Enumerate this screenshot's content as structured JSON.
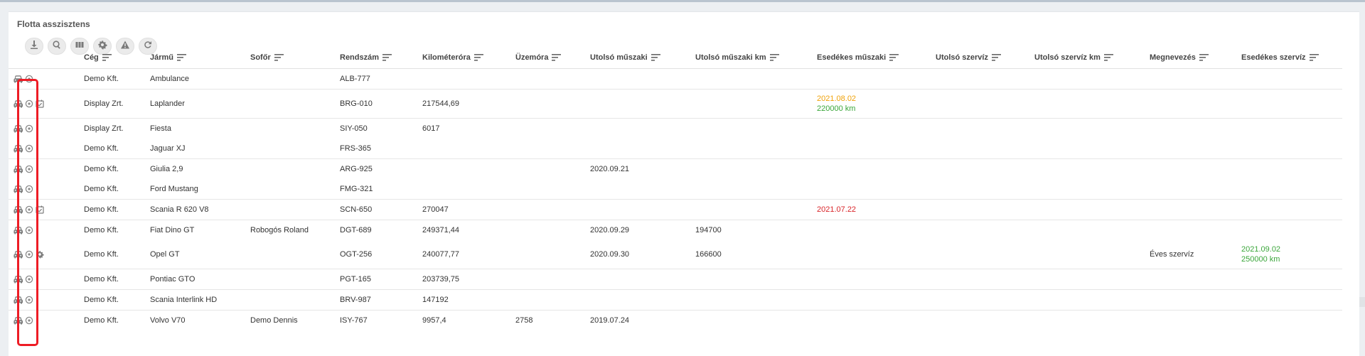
{
  "title": "Flotta asszisztens",
  "toolbar": {
    "buttons": [
      {
        "name": "download",
        "icon": "download-icon"
      },
      {
        "name": "search",
        "icon": "search-icon"
      },
      {
        "name": "columns",
        "icon": "columns-icon"
      },
      {
        "name": "settings",
        "icon": "gear-icon"
      },
      {
        "name": "warning",
        "icon": "warning-icon"
      },
      {
        "name": "refresh",
        "icon": "refresh-icon"
      }
    ]
  },
  "columns": {
    "ceg": "Cég",
    "jarmu": "Jármű",
    "sofor": "Sofőr",
    "rendszam": "Rendszám",
    "km": "Kilométeróra",
    "uzemora": "Üzemóra",
    "utolso_muszaki": "Utolsó műszaki",
    "utolso_muszaki_km": "Utolsó műszaki km",
    "esedekes_muszaki": "Esedékes műszaki",
    "utolso_szerviz": "Utolsó szervíz",
    "utolso_szerviz_km": "Utolsó szervíz km",
    "megnevezes": "Megnevezés",
    "esedekes_szerviz": "Esedékes szervíz"
  },
  "rows": [
    {
      "ceg": "Demo Kft.",
      "jarmu": "Ambulance",
      "sofor": "",
      "rendszam": "ALB-777",
      "km": "",
      "uzemora": "",
      "utolso_muszaki": "",
      "utolso_muszaki_km": "",
      "esedekes_muszaki_date": "",
      "esedekes_muszaki_km": "",
      "utolso_szerviz": "",
      "utolso_szerviz_km": "",
      "megnevezes": "",
      "esedekes_szerviz_date": "",
      "esedekes_szerviz_km": "",
      "extra_icon": ""
    },
    {
      "ceg": "Display Zrt.",
      "jarmu": "Laplander",
      "sofor": "",
      "rendszam": "BRG-010",
      "km": "217544,69",
      "uzemora": "",
      "utolso_muszaki": "",
      "utolso_muszaki_km": "",
      "esedekes_muszaki_date": "2021.08.02",
      "esedekes_muszaki_km": "220000 km",
      "utolso_szerviz": "",
      "utolso_szerviz_km": "",
      "megnevezes": "",
      "esedekes_szerviz_date": "",
      "esedekes_szerviz_km": "",
      "extra_icon": "calendar-check-icon"
    },
    {
      "ceg": "Display Zrt.",
      "jarmu": "Fiesta",
      "sofor": "",
      "rendszam": "SIY-050",
      "km": "6017",
      "uzemora": "",
      "utolso_muszaki": "",
      "utolso_muszaki_km": "",
      "esedekes_muszaki_date": "",
      "esedekes_muszaki_km": "",
      "utolso_szerviz": "",
      "utolso_szerviz_km": "",
      "megnevezes": "",
      "esedekes_szerviz_date": "",
      "esedekes_szerviz_km": "",
      "extra_icon": ""
    },
    {
      "ceg": "Demo Kft.",
      "jarmu": "Jaguar XJ",
      "sofor": "",
      "rendszam": "FRS-365",
      "km": "",
      "uzemora": "",
      "utolso_muszaki": "",
      "utolso_muszaki_km": "",
      "esedekes_muszaki_date": "",
      "esedekes_muszaki_km": "",
      "utolso_szerviz": "",
      "utolso_szerviz_km": "",
      "megnevezes": "",
      "esedekes_szerviz_date": "",
      "esedekes_szerviz_km": "",
      "extra_icon": ""
    },
    {
      "ceg": "Demo Kft.",
      "jarmu": "Giulia 2,9",
      "sofor": "",
      "rendszam": "ARG-925",
      "km": "",
      "uzemora": "",
      "utolso_muszaki": "2020.09.21",
      "utolso_muszaki_km": "",
      "esedekes_muszaki_date": "",
      "esedekes_muszaki_km": "",
      "utolso_szerviz": "",
      "utolso_szerviz_km": "",
      "megnevezes": "",
      "esedekes_szerviz_date": "",
      "esedekes_szerviz_km": "",
      "extra_icon": ""
    },
    {
      "ceg": "Demo Kft.",
      "jarmu": "Ford Mustang",
      "sofor": "",
      "rendszam": "FMG-321",
      "km": "",
      "uzemora": "",
      "utolso_muszaki": "",
      "utolso_muszaki_km": "",
      "esedekes_muszaki_date": "",
      "esedekes_muszaki_km": "",
      "utolso_szerviz": "",
      "utolso_szerviz_km": "",
      "megnevezes": "",
      "esedekes_szerviz_date": "",
      "esedekes_szerviz_km": "",
      "extra_icon": ""
    },
    {
      "ceg": "Demo Kft.",
      "jarmu": "Scania R 620 V8",
      "sofor": "",
      "rendszam": "SCN-650",
      "km": "270047",
      "uzemora": "",
      "utolso_muszaki": "",
      "utolso_muszaki_km": "",
      "esedekes_muszaki_date": "2021.07.22",
      "esedekes_muszaki_km": "",
      "utolso_szerviz": "",
      "utolso_szerviz_km": "",
      "megnevezes": "",
      "esedekes_szerviz_date": "",
      "esedekes_szerviz_km": "",
      "extra_icon": "calendar-check-icon"
    },
    {
      "ceg": "Demo Kft.",
      "jarmu": "Fiat Dino GT",
      "sofor": "Robogós Roland",
      "rendszam": "DGT-689",
      "km": "249371,44",
      "uzemora": "",
      "utolso_muszaki": "2020.09.29",
      "utolso_muszaki_km": "194700",
      "esedekes_muszaki_date": "",
      "esedekes_muszaki_km": "",
      "utolso_szerviz": "",
      "utolso_szerviz_km": "",
      "megnevezes": "",
      "esedekes_szerviz_date": "",
      "esedekes_szerviz_km": "",
      "extra_icon": ""
    },
    {
      "ceg": "Demo Kft.",
      "jarmu": "Opel GT",
      "sofor": "",
      "rendszam": "OGT-256",
      "km": "240077,77",
      "uzemora": "",
      "utolso_muszaki": "2020.09.30",
      "utolso_muszaki_km": "166600",
      "esedekes_muszaki_date": "",
      "esedekes_muszaki_km": "",
      "utolso_szerviz": "",
      "utolso_szerviz_km": "",
      "megnevezes": "Éves szervíz",
      "esedekes_szerviz_date": "2021.09.02",
      "esedekes_szerviz_km": "250000 km",
      "extra_icon": "gear-icon"
    },
    {
      "ceg": "Demo Kft.",
      "jarmu": "Pontiac GTO",
      "sofor": "",
      "rendszam": "PGT-165",
      "km": "203739,75",
      "uzemora": "",
      "utolso_muszaki": "",
      "utolso_muszaki_km": "",
      "esedekes_muszaki_date": "",
      "esedekes_muszaki_km": "",
      "utolso_szerviz": "",
      "utolso_szerviz_km": "",
      "megnevezes": "",
      "esedekes_szerviz_date": "",
      "esedekes_szerviz_km": "",
      "extra_icon": ""
    },
    {
      "ceg": "Demo Kft.",
      "jarmu": "Scania Interlink HD",
      "sofor": "",
      "rendszam": "BRV-987",
      "km": "147192",
      "uzemora": "",
      "utolso_muszaki": "",
      "utolso_muszaki_km": "",
      "esedekes_muszaki_date": "",
      "esedekes_muszaki_km": "",
      "utolso_szerviz": "",
      "utolso_szerviz_km": "",
      "megnevezes": "",
      "esedekes_szerviz_date": "",
      "esedekes_szerviz_km": "",
      "extra_icon": ""
    },
    {
      "ceg": "Demo Kft.",
      "jarmu": "Volvo V70",
      "sofor": "Demo Dennis",
      "rendszam": "ISY-767",
      "km": "9957,4",
      "uzemora": "2758",
      "utolso_muszaki": "2019.07.24",
      "utolso_muszaki_km": "",
      "esedekes_muszaki_date": "",
      "esedekes_muszaki_km": "",
      "utolso_szerviz": "",
      "utolso_szerviz_km": "",
      "megnevezes": "",
      "esedekes_szerviz_date": "",
      "esedekes_szerviz_km": "",
      "extra_icon": ""
    }
  ],
  "colors": {
    "accent_warning": "#f0a20a",
    "accent_ok": "#3aa63a",
    "accent_danger": "#d9252a",
    "highlight_box": "#ee1c25"
  }
}
